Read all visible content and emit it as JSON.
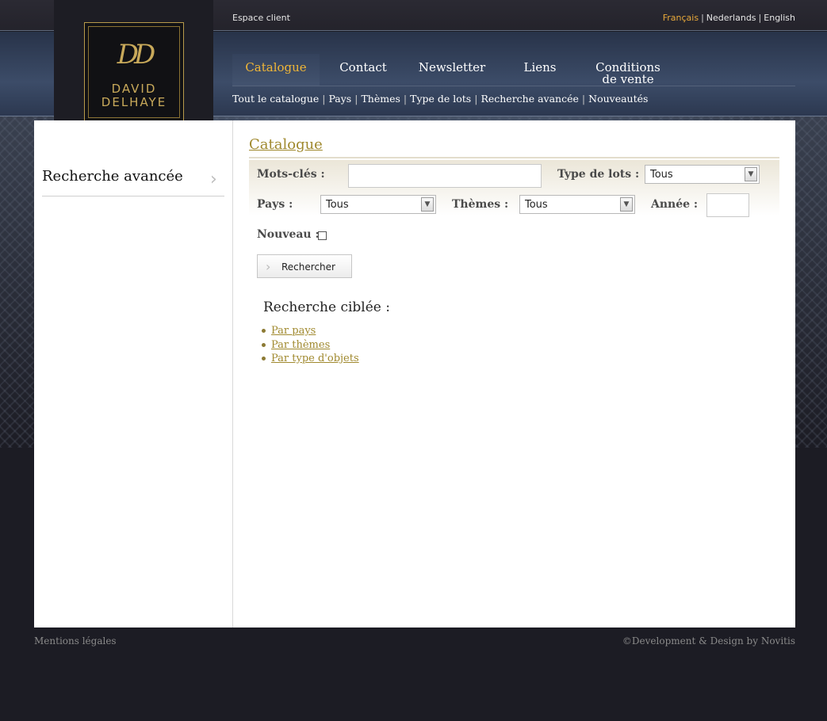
{
  "topbar": {
    "espace_client": "Espace client",
    "languages": [
      "Français",
      "Nederlands",
      "English"
    ],
    "active_language": "Français"
  },
  "logo": {
    "monogram": "DD",
    "line1": "DAVID",
    "line2": "DELHAYE"
  },
  "mainnav": {
    "items": [
      "Catalogue",
      "Contact",
      "Newsletter",
      "Liens",
      "Conditions de vente"
    ],
    "active": "Catalogue"
  },
  "subnav": {
    "items": [
      "Tout le catalogue",
      "Pays",
      "Thèmes",
      "Type de lots",
      "Recherche avancée",
      "Nouveautés"
    ]
  },
  "sidebar": {
    "title": "Recherche avancée"
  },
  "main": {
    "title": "Catalogue",
    "filters": {
      "keywords_label": "Mots-clés :",
      "keywords_value": "",
      "lot_type_label": "Type de lots :",
      "lot_type_value": "Tous",
      "country_label": "Pays :",
      "country_value": "Tous",
      "themes_label": "Thèmes :",
      "themes_value": "Tous",
      "year_label": "Année :",
      "year_value": "",
      "new_label": "Nouveau :",
      "new_checked": false
    },
    "search_button": "Rechercher",
    "targeted": {
      "title": "Recherche ciblée :",
      "links": [
        "Par pays",
        "Par thèmes",
        "Par type d'objets"
      ]
    }
  },
  "footer": {
    "left": "Mentions légales",
    "right": "©Development & Design by Novitis"
  },
  "colors": {
    "accent_gold": "#a0892e",
    "active_nav": "#f0b637",
    "language_active": "#e8a93a"
  }
}
